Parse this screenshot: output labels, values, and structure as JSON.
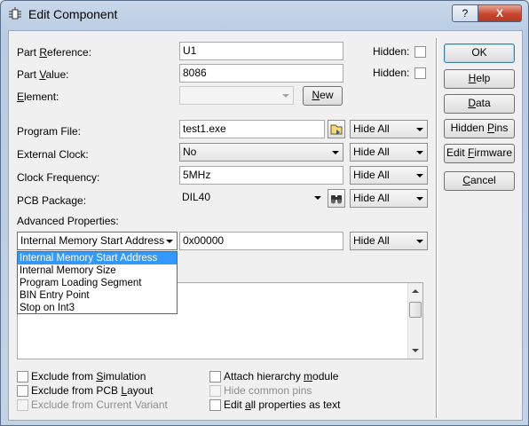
{
  "window": {
    "title": "Edit Component",
    "help_btn": "?",
    "close_btn": "X"
  },
  "fields": {
    "part_reference": {
      "label_pre": "Part ",
      "label_ul": "R",
      "label_post": "eference:",
      "value": "U1",
      "hidden_label": "Hidden:",
      "hidden_checked": false
    },
    "part_value": {
      "label_pre": "Part ",
      "label_ul": "V",
      "label_post": "alue:",
      "value": "8086",
      "hidden_label": "Hidden:",
      "hidden_checked": false
    },
    "element": {
      "label_ul": "E",
      "label_post": "lement:",
      "value": "",
      "new_button_ul": "N",
      "new_button_post": "ew"
    },
    "program_file": {
      "label": "Program File:",
      "value": "test1.exe",
      "visibility": "Hide All"
    },
    "external_clock": {
      "label": "External Clock:",
      "value": "No",
      "visibility": "Hide All"
    },
    "clock_frequency": {
      "label": "Clock Frequency:",
      "value": "5MHz",
      "visibility": "Hide All"
    },
    "pcb_package": {
      "label": "PCB Package:",
      "value": "DIL40",
      "visibility": "Hide All"
    }
  },
  "advanced": {
    "label": "Advanced Properties:",
    "selected": "Internal Memory Start Address",
    "value": "0x00000",
    "visibility": "Hide All",
    "options": [
      "Internal Memory Start Address",
      "Internal Memory Size",
      "Program Loading Segment",
      "BIN Entry Point",
      "Stop on Int3"
    ]
  },
  "buttons": {
    "ok": "OK",
    "help_ul": "H",
    "help_post": "elp",
    "data_ul": "D",
    "data_post": "ata",
    "hidden_pins_pre": "Hidden ",
    "hidden_pins_ul": "P",
    "hidden_pins_post": "ins",
    "edit_firmware_pre": "Edit ",
    "edit_firmware_ul": "F",
    "edit_firmware_post": "irmware",
    "cancel_ul": "C",
    "cancel_post": "ancel"
  },
  "checkboxes": {
    "exclude_sim": {
      "pre": "Exclude from ",
      "ul": "S",
      "post": "imulation",
      "checked": false
    },
    "exclude_pcb": {
      "pre": "Exclude from PCB ",
      "ul": "L",
      "post": "ayout",
      "checked": false
    },
    "exclude_variant": {
      "label": "Exclude from Current Variant",
      "checked": false,
      "disabled": true
    },
    "attach_hierarchy": {
      "pre": "Attach hierarchy ",
      "ul": "m",
      "post": "odule",
      "checked": false
    },
    "hide_common_pins": {
      "label": "Hide common pins",
      "checked": false,
      "disabled": true
    },
    "edit_all_props": {
      "pre": "Edit ",
      "ul": "a",
      "post": "ll properties as text",
      "checked": false
    }
  },
  "icons": [
    "component-icon",
    "browse-folder-icon",
    "binoculars-icon",
    "dropdown-arrow-icon"
  ]
}
